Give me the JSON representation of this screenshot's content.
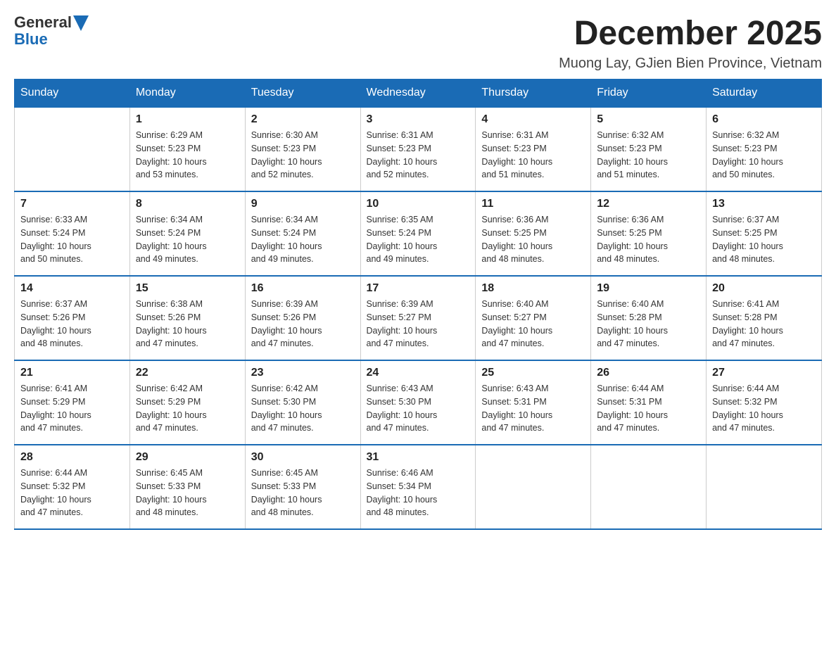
{
  "header": {
    "logo_general": "General",
    "logo_blue": "Blue",
    "title": "December 2025",
    "location": "Muong Lay, GJien Bien Province, Vietnam"
  },
  "days_of_week": [
    "Sunday",
    "Monday",
    "Tuesday",
    "Wednesday",
    "Thursday",
    "Friday",
    "Saturday"
  ],
  "weeks": [
    [
      {
        "day": "",
        "info": ""
      },
      {
        "day": "1",
        "info": "Sunrise: 6:29 AM\nSunset: 5:23 PM\nDaylight: 10 hours\nand 53 minutes."
      },
      {
        "day": "2",
        "info": "Sunrise: 6:30 AM\nSunset: 5:23 PM\nDaylight: 10 hours\nand 52 minutes."
      },
      {
        "day": "3",
        "info": "Sunrise: 6:31 AM\nSunset: 5:23 PM\nDaylight: 10 hours\nand 52 minutes."
      },
      {
        "day": "4",
        "info": "Sunrise: 6:31 AM\nSunset: 5:23 PM\nDaylight: 10 hours\nand 51 minutes."
      },
      {
        "day": "5",
        "info": "Sunrise: 6:32 AM\nSunset: 5:23 PM\nDaylight: 10 hours\nand 51 minutes."
      },
      {
        "day": "6",
        "info": "Sunrise: 6:32 AM\nSunset: 5:23 PM\nDaylight: 10 hours\nand 50 minutes."
      }
    ],
    [
      {
        "day": "7",
        "info": "Sunrise: 6:33 AM\nSunset: 5:24 PM\nDaylight: 10 hours\nand 50 minutes."
      },
      {
        "day": "8",
        "info": "Sunrise: 6:34 AM\nSunset: 5:24 PM\nDaylight: 10 hours\nand 49 minutes."
      },
      {
        "day": "9",
        "info": "Sunrise: 6:34 AM\nSunset: 5:24 PM\nDaylight: 10 hours\nand 49 minutes."
      },
      {
        "day": "10",
        "info": "Sunrise: 6:35 AM\nSunset: 5:24 PM\nDaylight: 10 hours\nand 49 minutes."
      },
      {
        "day": "11",
        "info": "Sunrise: 6:36 AM\nSunset: 5:25 PM\nDaylight: 10 hours\nand 48 minutes."
      },
      {
        "day": "12",
        "info": "Sunrise: 6:36 AM\nSunset: 5:25 PM\nDaylight: 10 hours\nand 48 minutes."
      },
      {
        "day": "13",
        "info": "Sunrise: 6:37 AM\nSunset: 5:25 PM\nDaylight: 10 hours\nand 48 minutes."
      }
    ],
    [
      {
        "day": "14",
        "info": "Sunrise: 6:37 AM\nSunset: 5:26 PM\nDaylight: 10 hours\nand 48 minutes."
      },
      {
        "day": "15",
        "info": "Sunrise: 6:38 AM\nSunset: 5:26 PM\nDaylight: 10 hours\nand 47 minutes."
      },
      {
        "day": "16",
        "info": "Sunrise: 6:39 AM\nSunset: 5:26 PM\nDaylight: 10 hours\nand 47 minutes."
      },
      {
        "day": "17",
        "info": "Sunrise: 6:39 AM\nSunset: 5:27 PM\nDaylight: 10 hours\nand 47 minutes."
      },
      {
        "day": "18",
        "info": "Sunrise: 6:40 AM\nSunset: 5:27 PM\nDaylight: 10 hours\nand 47 minutes."
      },
      {
        "day": "19",
        "info": "Sunrise: 6:40 AM\nSunset: 5:28 PM\nDaylight: 10 hours\nand 47 minutes."
      },
      {
        "day": "20",
        "info": "Sunrise: 6:41 AM\nSunset: 5:28 PM\nDaylight: 10 hours\nand 47 minutes."
      }
    ],
    [
      {
        "day": "21",
        "info": "Sunrise: 6:41 AM\nSunset: 5:29 PM\nDaylight: 10 hours\nand 47 minutes."
      },
      {
        "day": "22",
        "info": "Sunrise: 6:42 AM\nSunset: 5:29 PM\nDaylight: 10 hours\nand 47 minutes."
      },
      {
        "day": "23",
        "info": "Sunrise: 6:42 AM\nSunset: 5:30 PM\nDaylight: 10 hours\nand 47 minutes."
      },
      {
        "day": "24",
        "info": "Sunrise: 6:43 AM\nSunset: 5:30 PM\nDaylight: 10 hours\nand 47 minutes."
      },
      {
        "day": "25",
        "info": "Sunrise: 6:43 AM\nSunset: 5:31 PM\nDaylight: 10 hours\nand 47 minutes."
      },
      {
        "day": "26",
        "info": "Sunrise: 6:44 AM\nSunset: 5:31 PM\nDaylight: 10 hours\nand 47 minutes."
      },
      {
        "day": "27",
        "info": "Sunrise: 6:44 AM\nSunset: 5:32 PM\nDaylight: 10 hours\nand 47 minutes."
      }
    ],
    [
      {
        "day": "28",
        "info": "Sunrise: 6:44 AM\nSunset: 5:32 PM\nDaylight: 10 hours\nand 47 minutes."
      },
      {
        "day": "29",
        "info": "Sunrise: 6:45 AM\nSunset: 5:33 PM\nDaylight: 10 hours\nand 48 minutes."
      },
      {
        "day": "30",
        "info": "Sunrise: 6:45 AM\nSunset: 5:33 PM\nDaylight: 10 hours\nand 48 minutes."
      },
      {
        "day": "31",
        "info": "Sunrise: 6:46 AM\nSunset: 5:34 PM\nDaylight: 10 hours\nand 48 minutes."
      },
      {
        "day": "",
        "info": ""
      },
      {
        "day": "",
        "info": ""
      },
      {
        "day": "",
        "info": ""
      }
    ]
  ]
}
